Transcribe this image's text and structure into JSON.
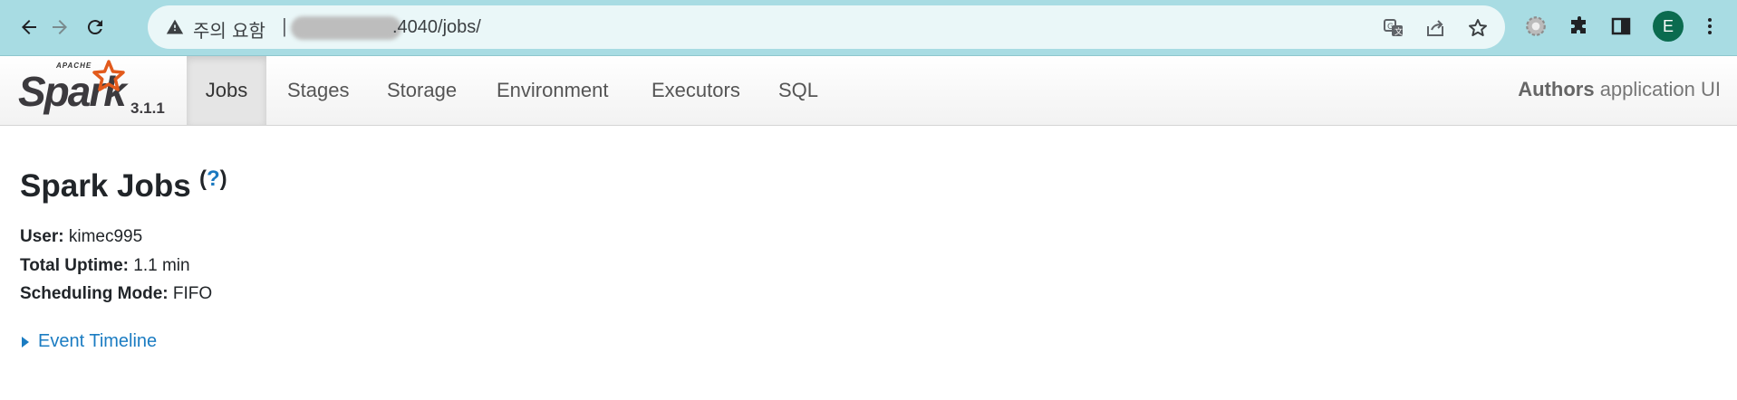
{
  "browser": {
    "security_label": "주의 요함",
    "separator": "|",
    "url_visible": ".4040/jobs/",
    "avatar_letter": "E",
    "icons": [
      "back-arrow-icon",
      "forward-arrow-icon",
      "reload-icon",
      "warning-icon",
      "translate-icon",
      "share-icon",
      "bookmark-star-icon",
      "extension-gear-icon",
      "extensions-puzzle-icon",
      "side-panel-icon",
      "profile-avatar",
      "more-menu-icon"
    ]
  },
  "spark": {
    "logo_top": "APACHE",
    "logo_text": "Spark",
    "version": "3.1.1",
    "tabs": [
      {
        "label": "Jobs",
        "active": true
      },
      {
        "label": "Stages",
        "active": false
      },
      {
        "label": "Storage",
        "active": false
      },
      {
        "label": "Environment",
        "active": false
      },
      {
        "label": "Executors",
        "active": false
      },
      {
        "label": "SQL",
        "active": false
      }
    ],
    "app_name_bold": "Authors",
    "app_name_rest": "application UI"
  },
  "content": {
    "title": "Spark Jobs",
    "help_open": "(",
    "help_q": "?",
    "help_close": ")",
    "user_label": "User:",
    "user_value": "kimec995",
    "uptime_label": "Total Uptime:",
    "uptime_value": "1.1 min",
    "sched_label": "Scheduling Mode:",
    "sched_value": "FIFO",
    "event_timeline": "Event Timeline"
  },
  "colors": {
    "chrome_bg": "#a8dce3",
    "omnibox_bg": "#eaf7f8",
    "link": "#1b7cc2",
    "avatar": "#0b6b4f",
    "logo_star": "#e25a1c"
  }
}
